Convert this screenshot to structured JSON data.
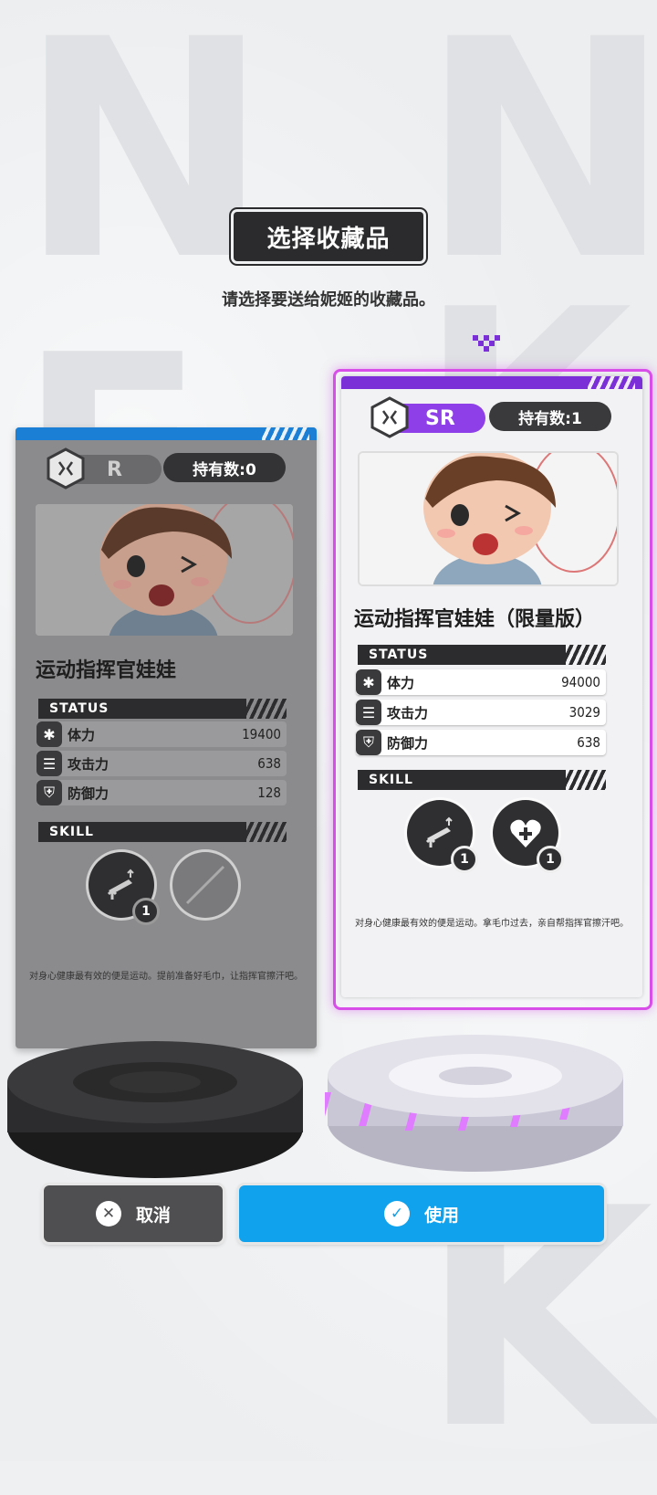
{
  "dialog": {
    "title": "选择收藏品",
    "subtitle": "请选择要送给妮姬的收藏品。"
  },
  "cards": [
    {
      "rarity": "R",
      "owned_text": "持有数:0",
      "name": "运动指挥官娃娃",
      "status_header": "STATUS",
      "stats": [
        {
          "label": "体力",
          "value": "19400",
          "icon": "asterisk-icon"
        },
        {
          "label": "攻击力",
          "value": "638",
          "icon": "bullets-icon"
        },
        {
          "label": "防御力",
          "value": "128",
          "icon": "shield-icon"
        }
      ],
      "skill_header": "SKILL",
      "skills": [
        {
          "icon": "attack-up-icon",
          "level": "1"
        },
        {
          "icon": "empty-slot-icon",
          "level": ""
        }
      ],
      "description": "对身心健康最有效的便是运动。提前准备好毛巾，让指挥官擦汗吧。",
      "accent_color": "#1b7fd6",
      "state": "dimmed"
    },
    {
      "rarity": "SR",
      "owned_text": "持有数:1",
      "name": "运动指挥官娃娃（限量版）",
      "status_header": "STATUS",
      "stats": [
        {
          "label": "体力",
          "value": "94000",
          "icon": "asterisk-icon"
        },
        {
          "label": "攻击力",
          "value": "3029",
          "icon": "bullets-icon"
        },
        {
          "label": "防御力",
          "value": "638",
          "icon": "shield-icon"
        }
      ],
      "skill_header": "SKILL",
      "skills": [
        {
          "icon": "attack-up-icon",
          "level": "1"
        },
        {
          "icon": "heart-heal-icon",
          "level": "1"
        }
      ],
      "description": "对身心健康最有效的便是运动。拿毛巾过去，亲自帮指挥官擦汗吧。",
      "accent_color": "#7b2fd6",
      "state": "selected"
    }
  ],
  "buttons": {
    "cancel": "取消",
    "use": "使用"
  },
  "colors": {
    "selected_border": "#d74ee9",
    "use_button": "#11a2ee",
    "cancel_button": "#4f4f51"
  }
}
